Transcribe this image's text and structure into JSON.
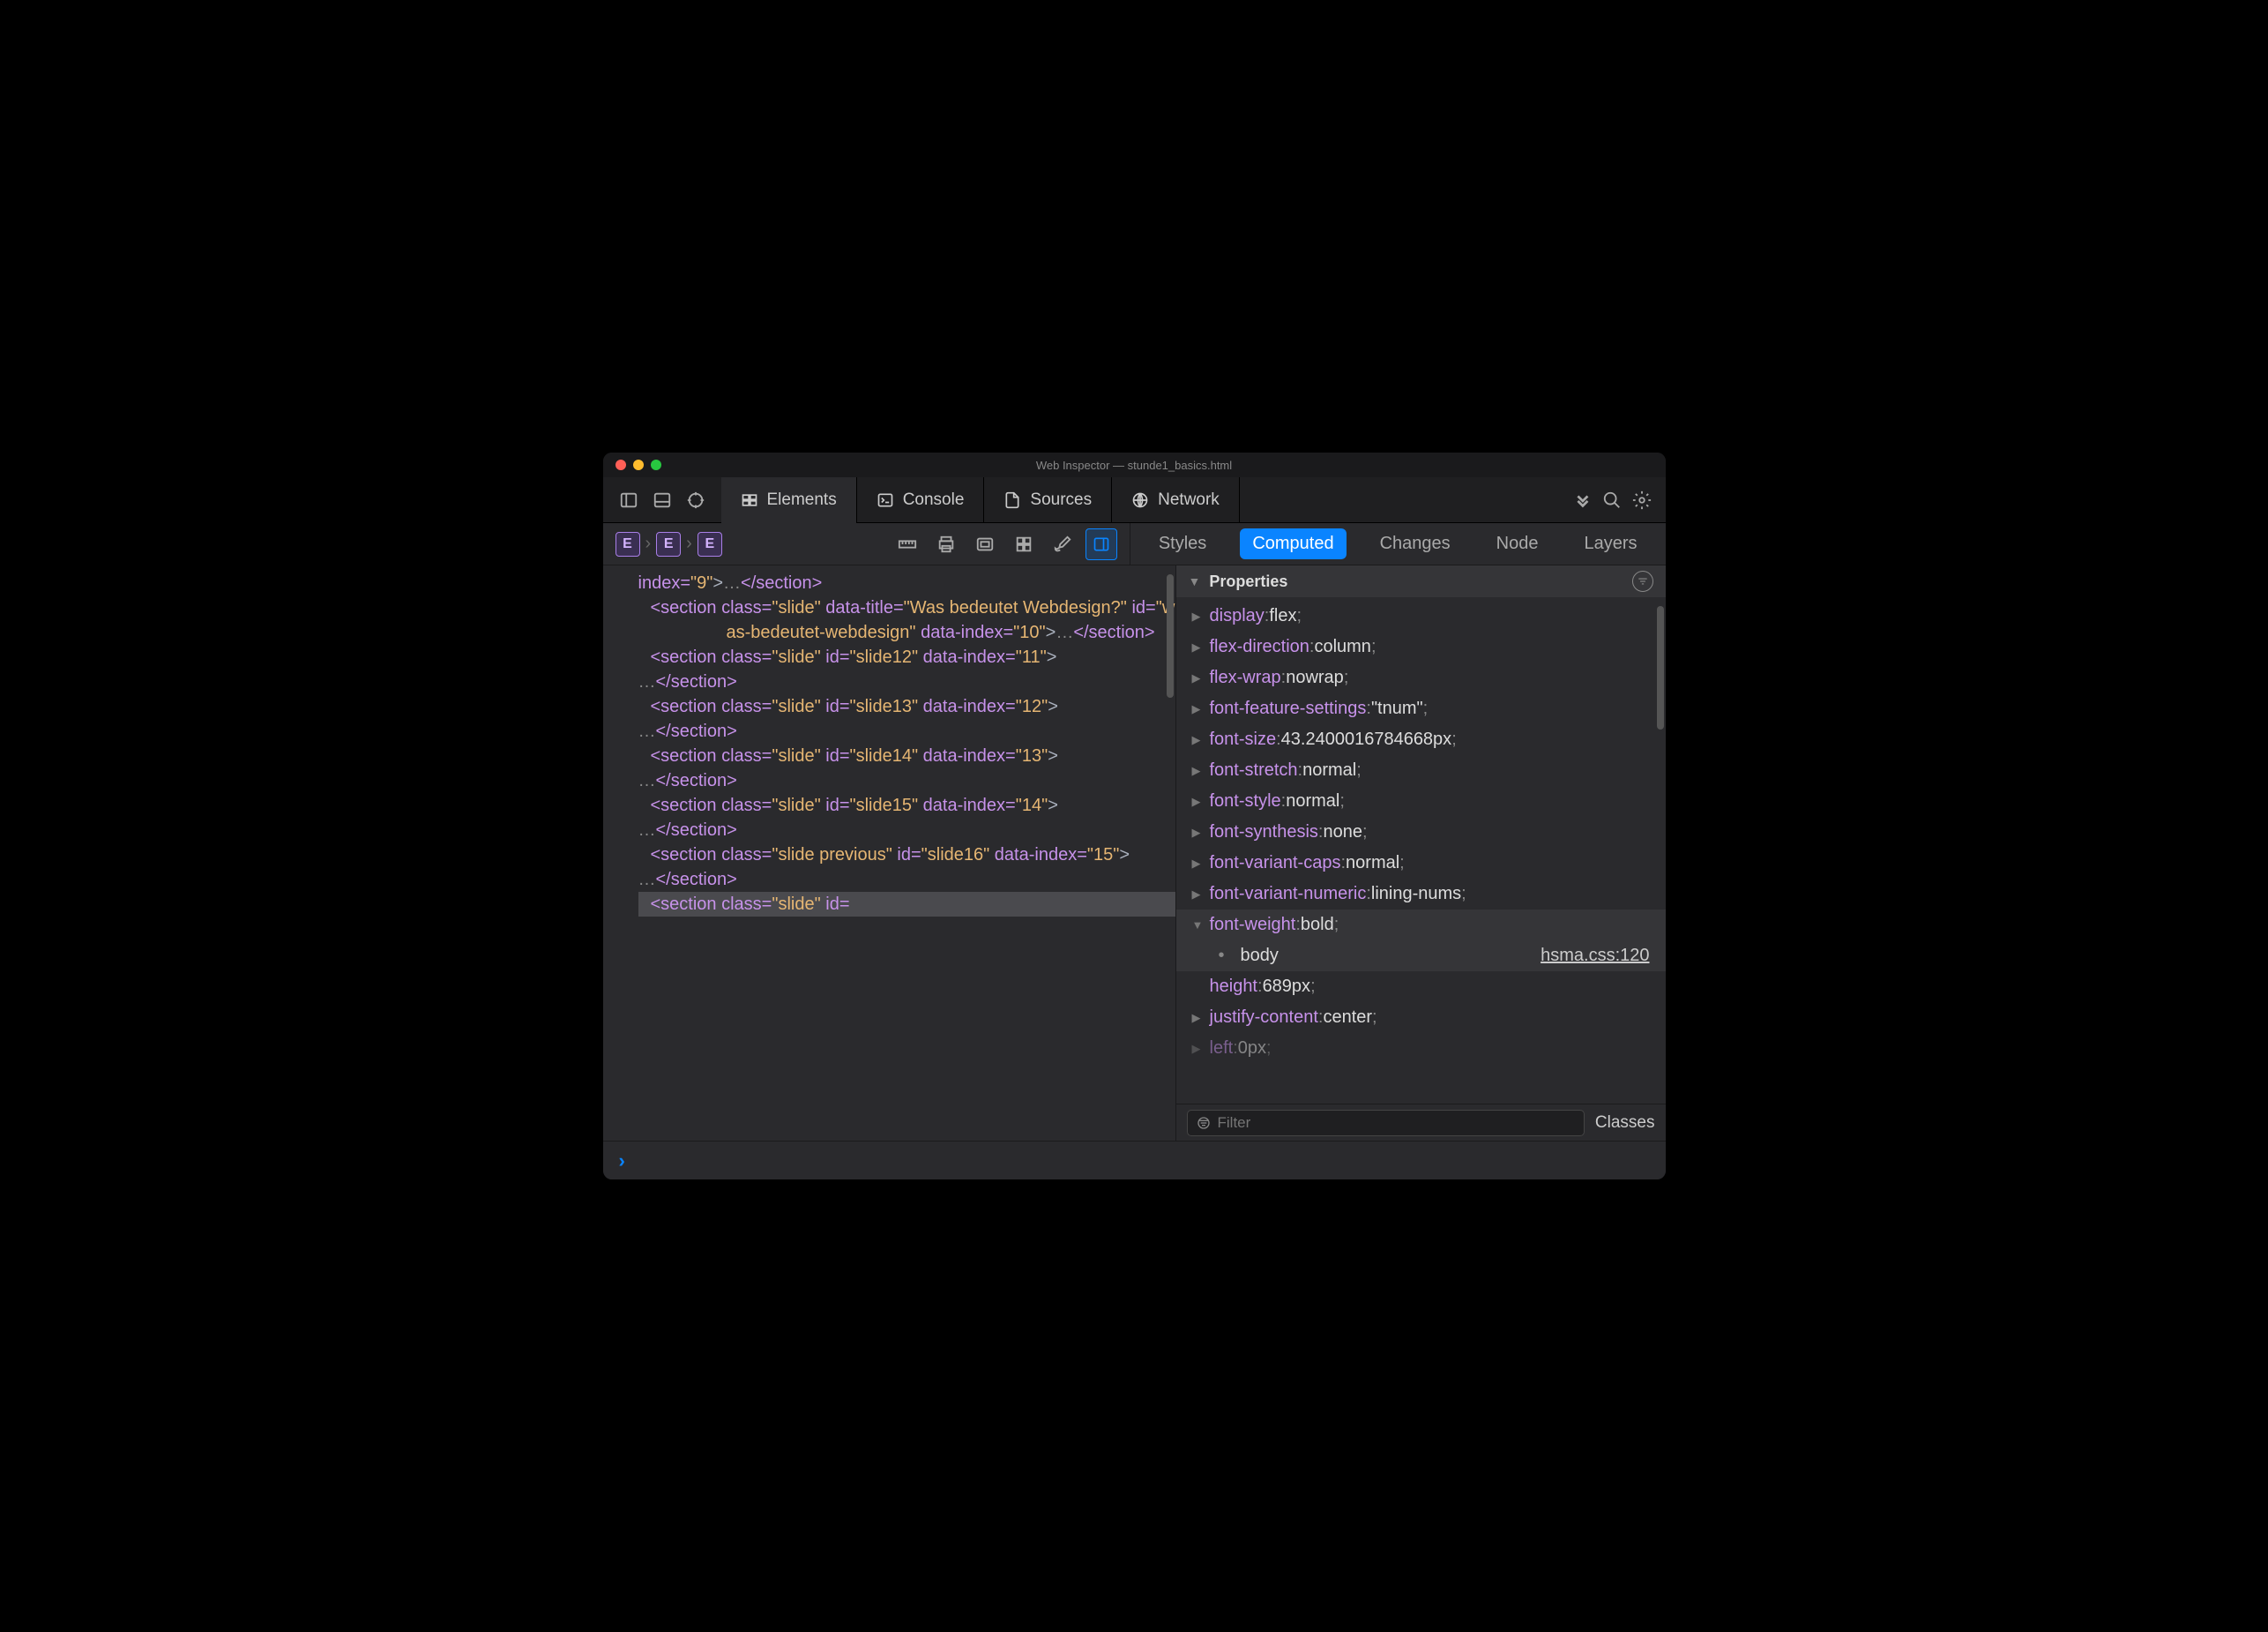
{
  "window": {
    "title": "Web Inspector — stunde1_basics.html"
  },
  "tabs": [
    "Elements",
    "Console",
    "Sources",
    "Network"
  ],
  "breadcrumbs": [
    "E",
    "E",
    "E"
  ],
  "subtabs": [
    "Styles",
    "Computed",
    "Changes",
    "Node",
    "Layers"
  ],
  "propsHeader": "Properties",
  "dom": [
    {
      "pre": "index=",
      "val": "\"9\"",
      "post": ">",
      "ellip": true,
      "close": "</section>"
    },
    {
      "tri": true,
      "open": "<section ",
      "attrs": [
        [
          "class",
          "\"slide\""
        ],
        [
          "data-title",
          "\"Was bedeutet Webdesign?\""
        ],
        [
          "id",
          "\"was-bedeutet-webdesign\""
        ],
        [
          "data-index",
          "\"10\""
        ]
      ],
      "post": ">",
      "ellip": true,
      "close": "</section>"
    },
    {
      "tri": true,
      "open": "<section ",
      "attrs": [
        [
          "class",
          "\"slide\""
        ],
        [
          "id",
          "\"slide12\""
        ],
        [
          "data-index",
          "\"11\""
        ]
      ],
      "post": ">",
      "nl": true,
      "ellip": true,
      "close": "</section>"
    },
    {
      "tri": true,
      "open": "<section ",
      "attrs": [
        [
          "class",
          "\"slide\""
        ],
        [
          "id",
          "\"slide13\""
        ],
        [
          "data-index",
          "\"12\""
        ]
      ],
      "post": ">",
      "nl": true,
      "ellip": true,
      "close": "</section>"
    },
    {
      "tri": true,
      "open": "<section ",
      "attrs": [
        [
          "class",
          "\"slide\""
        ],
        [
          "id",
          "\"slide14\""
        ],
        [
          "data-index",
          "\"13\""
        ]
      ],
      "post": ">",
      "nl": true,
      "ellip": true,
      "close": "</section>"
    },
    {
      "tri": true,
      "open": "<section ",
      "attrs": [
        [
          "class",
          "\"slide\""
        ],
        [
          "id",
          "\"slide15\""
        ],
        [
          "data-index",
          "\"14\""
        ]
      ],
      "post": ">",
      "nl": true,
      "ellip": true,
      "close": "</section>"
    },
    {
      "tri": true,
      "open": "<section ",
      "attrs": [
        [
          "class",
          "\"slide previous\""
        ],
        [
          "id",
          "\"slide16\""
        ],
        [
          "data-index",
          "\"15\""
        ]
      ],
      "post": ">",
      "nl": true,
      "ellip": true,
      "close": "</section>"
    },
    {
      "tri": true,
      "open": "<section ",
      "attrs": [
        [
          "class",
          "\"slide\""
        ],
        [
          "id",
          ""
        ]
      ],
      "sel": true
    }
  ],
  "props": [
    {
      "name": "display",
      "value": "flex"
    },
    {
      "name": "flex-direction",
      "value": "column"
    },
    {
      "name": "flex-wrap",
      "value": "nowrap"
    },
    {
      "name": "font-feature-settings",
      "value": "\"tnum\""
    },
    {
      "name": "font-size",
      "value": "43.2400016784668px"
    },
    {
      "name": "font-stretch",
      "value": "normal"
    },
    {
      "name": "font-style",
      "value": "normal"
    },
    {
      "name": "font-synthesis",
      "value": "none"
    },
    {
      "name": "font-variant-caps",
      "value": "normal"
    },
    {
      "name": "font-variant-numeric",
      "value": "lining-nums"
    },
    {
      "name": "font-weight",
      "value": "bold",
      "expanded": true,
      "sub": {
        "selector": "body",
        "link": "hsma.css:120"
      }
    },
    {
      "name": "height",
      "value": "689px",
      "notri": true
    },
    {
      "name": "justify-content",
      "value": "center"
    },
    {
      "name": "left",
      "value": "0px",
      "cut": true
    }
  ],
  "filter": {
    "placeholder": "Filter"
  },
  "classesLabel": "Classes"
}
